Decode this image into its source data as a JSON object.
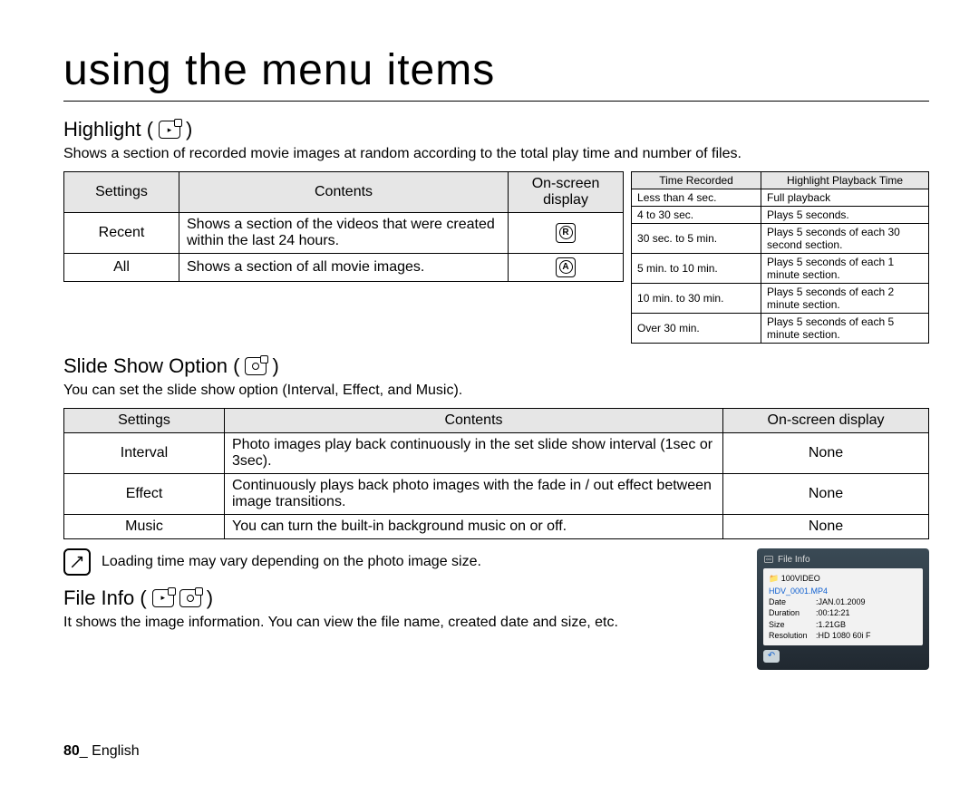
{
  "page_title": "using the menu items",
  "highlight": {
    "heading": "Highlight (",
    "heading_close": ")",
    "desc": "Shows a section of recorded movie images at random according to the total play time and number of files.",
    "table": {
      "headers": [
        "Settings",
        "Contents",
        "On-screen display"
      ],
      "rows": [
        {
          "setting": "Recent",
          "contents": "Shows a section of the videos that were created within the last 24 hours.",
          "osd": "R"
        },
        {
          "setting": "All",
          "contents": "Shows a section of all movie images.",
          "osd": "A"
        }
      ]
    },
    "time_table": {
      "headers": [
        "Time Recorded",
        "Highlight Playback Time"
      ],
      "rows": [
        {
          "t": "Less than 4 sec.",
          "p": "Full playback"
        },
        {
          "t": "4 to 30 sec.",
          "p": "Plays 5 seconds."
        },
        {
          "t": "30 sec. to 5 min.",
          "p": "Plays 5 seconds of each 30 second section."
        },
        {
          "t": "5 min. to 10 min.",
          "p": "Plays 5 seconds of each 1 minute section."
        },
        {
          "t": "10 min. to 30 min.",
          "p": "Plays 5 seconds of each 2 minute section."
        },
        {
          "t": "Over 30 min.",
          "p": "Plays 5 seconds of each 5 minute section."
        }
      ]
    }
  },
  "slideshow": {
    "heading": "Slide Show Option (",
    "heading_close": ")",
    "desc": "You can set the slide show option (Interval, Effect, and Music).",
    "table": {
      "headers": [
        "Settings",
        "Contents",
        "On-screen display"
      ],
      "rows": [
        {
          "s": "Interval",
          "c": "Photo images play back continuously in the set slide show interval (1sec or 3sec).",
          "o": "None"
        },
        {
          "s": "Effect",
          "c": "Continuously plays back photo images with the fade in / out effect between image transitions.",
          "o": "None"
        },
        {
          "s": "Music",
          "c": "You can turn the built-in background music on or off.",
          "o": "None"
        }
      ]
    },
    "note": "Loading time may vary depending on the photo image size."
  },
  "fileinfo": {
    "heading": "File Info (",
    "heading_close": ")",
    "desc": "It shows the image information. You can view the file name, created date and size, etc.",
    "panel": {
      "title": "File Info",
      "folder": "100VIDEO",
      "filename": "HDV_0001.MP4",
      "rows": [
        {
          "k": "Date",
          "v": "JAN.01.2009"
        },
        {
          "k": "Duration",
          "v": "00:12:21"
        },
        {
          "k": "Size",
          "v": "1.21GB"
        },
        {
          "k": "Resolution",
          "v": "HD 1080 60i F"
        }
      ]
    }
  },
  "footer": {
    "page": "80",
    "sep": "_",
    "lang": "English"
  }
}
